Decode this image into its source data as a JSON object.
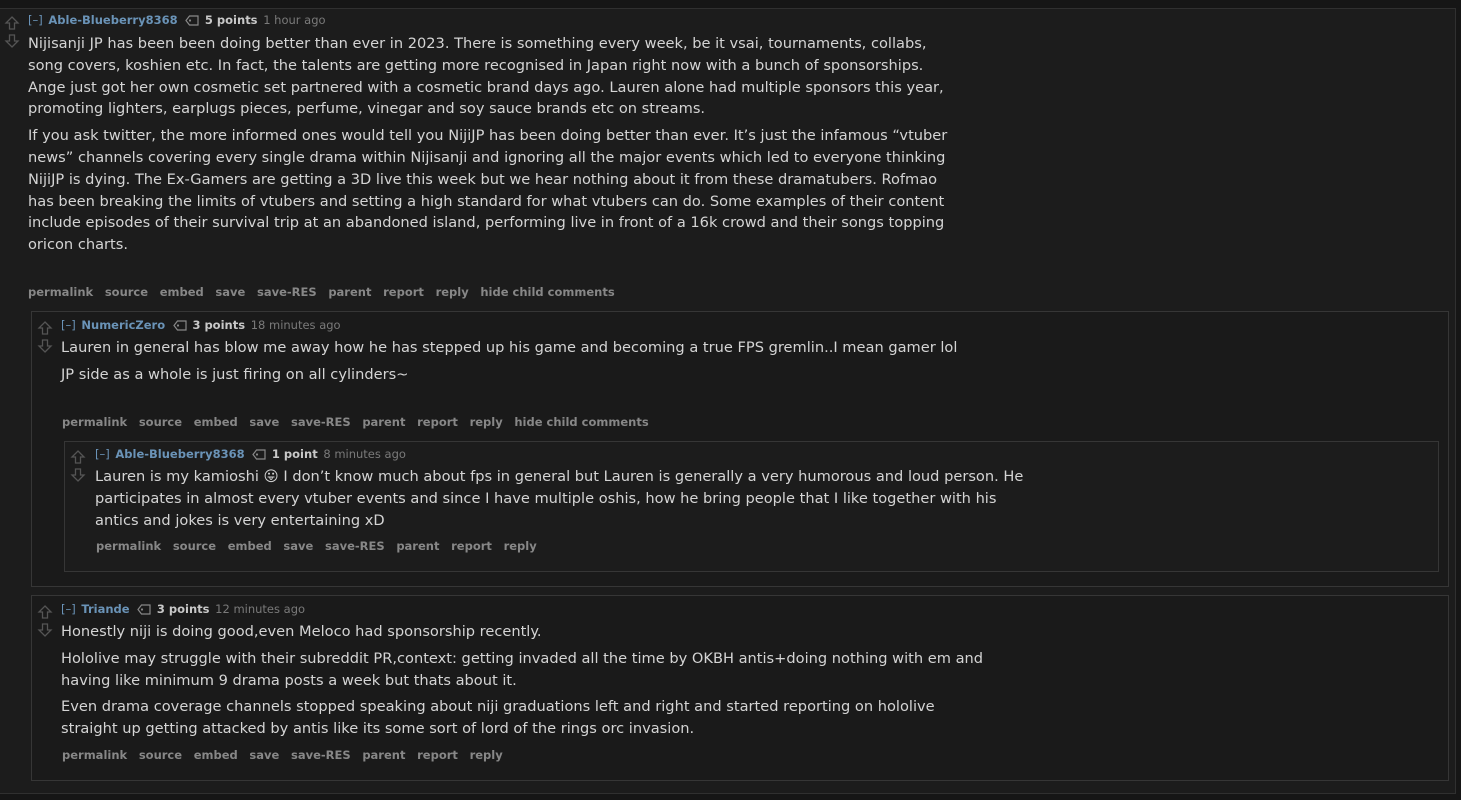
{
  "comments": [
    {
      "expand": "[–]",
      "author": "Able-Blueberry8368",
      "score": "5 points",
      "time": "1 hour ago",
      "paragraphs": [
        "Nijisanji JP has been been doing better than ever in 2023. There is something every week, be it vsai, tournaments, collabs, song covers, koshien etc. In fact, the talents are getting more recognised in Japan right now with a bunch of sponsorships. Ange just got her own cosmetic set partnered with a cosmetic brand days ago. Lauren alone had multiple sponsors this year, promoting lighters, earplugs pieces, perfume, vinegar and soy sauce brands etc on streams.",
        "If you ask twitter, the more informed ones would tell you NijiJP has been doing better than ever. It’s just the infamous “vtuber news” channels covering every single drama within Nijisanji and ignoring all the major events which led to everyone thinking NijiJP is dying. The Ex-Gamers are getting a 3D live this week but we hear nothing about it from these dramatubers. Rofmao has been breaking the limits of vtubers and setting a high standard for what vtubers can do. Some examples of their content include episodes of their survival trip at an abandoned island, performing live in front of a 16k crowd and their songs topping oricon charts."
      ],
      "buttons": [
        "permalink",
        "source",
        "embed",
        "save",
        "save-RES",
        "parent",
        "report",
        "reply",
        "hide child comments"
      ]
    },
    {
      "expand": "[–]",
      "author": "NumericZero",
      "score": "3 points",
      "time": "18 minutes ago",
      "paragraphs": [
        "Lauren in general has blow me away how he has stepped up his game and becoming a true FPS gremlin..I mean gamer lol",
        "JP side as a whole is just firing on all cylinders~"
      ],
      "buttons": [
        "permalink",
        "source",
        "embed",
        "save",
        "save-RES",
        "parent",
        "report",
        "reply",
        "hide child comments"
      ]
    },
    {
      "expand": "[–]",
      "author": "Able-Blueberry8368",
      "score": "1 point",
      "time": "8 minutes ago",
      "paragraphs": [
        "Lauren is my kamioshi 😛 I don’t know much about fps in general but Lauren is generally a very humorous and loud person. He participates in almost every vtuber events and since I have multiple oshis, how he bring people that I like together with his antics and jokes is very entertaining xD"
      ],
      "buttons": [
        "permalink",
        "source",
        "embed",
        "save",
        "save-RES",
        "parent",
        "report",
        "reply"
      ]
    },
    {
      "expand": "[–]",
      "author": "Triande",
      "score": "3 points",
      "time": "12 minutes ago",
      "paragraphs": [
        "Honestly niji is doing good,even Meloco had sponsorship recently.",
        "Hololive may struggle with their subreddit PR,context: getting invaded all the time by OKBH antis+doing nothing with em and having like minimum 9 drama posts a week but thats about it.",
        "Even drama coverage channels stopped speaking about niji graduations left and right and started reporting on hololive straight up getting attacked by antis like its some sort of lord of the rings orc invasion."
      ],
      "buttons": [
        "permalink",
        "source",
        "embed",
        "save",
        "save-RES",
        "parent",
        "report",
        "reply"
      ]
    }
  ],
  "icons": {
    "upvote": "up-arrow-icon",
    "downvote": "down-arrow-icon",
    "tag": "tag-icon"
  },
  "colors": {
    "author": "#6a93b7",
    "background": "#1c1c1c",
    "text": "#d4d4d4",
    "buttons": "#878787"
  }
}
